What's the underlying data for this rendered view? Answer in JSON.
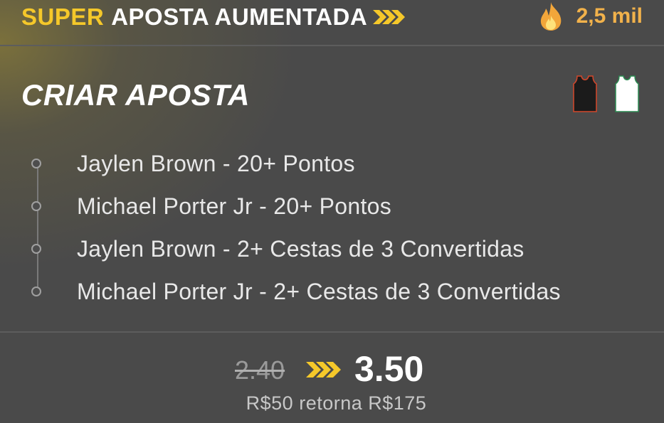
{
  "header": {
    "super_label": "SUPER",
    "title_rest": "APOSTA AUMENTADA",
    "views_count": "2,5 mil",
    "accent_color": "#f5c82a",
    "views_color": "#f2b24b",
    "icons": {
      "boost": "double-chevron-right-icon",
      "views": "flame-icon"
    }
  },
  "bet": {
    "title": "CRIAR APOSTA",
    "teams": [
      {
        "icon": "jersey-icon",
        "color": "#1b1b1b",
        "trim": "#d4472b"
      },
      {
        "icon": "jersey-icon",
        "color": "#ffffff",
        "trim": "#2c8a52"
      }
    ],
    "legs": [
      {
        "label": "Jaylen Brown - 20+ Pontos"
      },
      {
        "label": "Michael Porter Jr - 20+ Pontos"
      },
      {
        "label": "Jaylen Brown - 2+ Cestas de 3 Convertidas"
      },
      {
        "label": "Michael Porter Jr - 2+ Cestas de 3 Convertidas"
      }
    ]
  },
  "odds": {
    "old": "2.40",
    "new": "3.50",
    "returns": "R$50 retorna R$175"
  }
}
